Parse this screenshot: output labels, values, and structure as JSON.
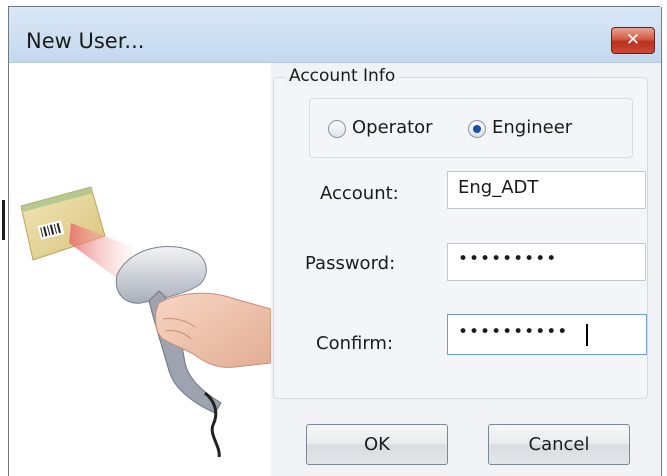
{
  "window": {
    "title": "New User...",
    "close_icon": "close-icon"
  },
  "image": {
    "description_icon": "barcode-scanner-illustration"
  },
  "account_info": {
    "group_title": "Account Info",
    "roles": [
      {
        "label": "Operator",
        "selected": false
      },
      {
        "label": "Engineer",
        "selected": true
      }
    ],
    "account_label": "Account:",
    "account_value": "Eng_ADT",
    "password_label": "Password:",
    "password_value": "•••••••••",
    "confirm_label": "Confirm:",
    "confirm_value": "••••••••••"
  },
  "buttons": {
    "ok_label": "OK",
    "cancel_label": "Cancel"
  },
  "colors": {
    "titlebar": "#cfe0f2",
    "close_button": "#c9432d",
    "radio_selected": "#1c4fa6"
  }
}
